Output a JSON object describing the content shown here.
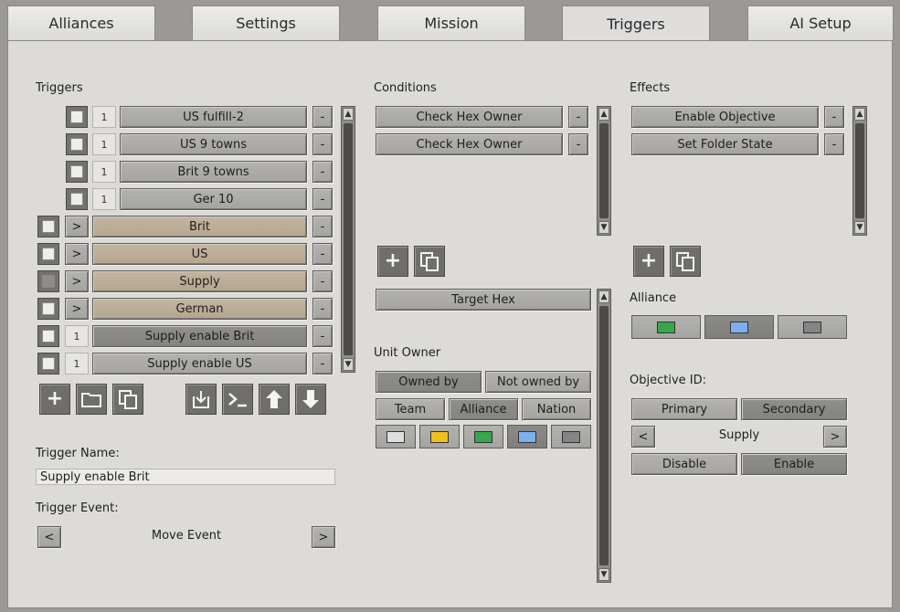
{
  "tabs": [
    {
      "label": "Alliances"
    },
    {
      "label": "Settings"
    },
    {
      "label": "Mission"
    },
    {
      "label": "Triggers"
    },
    {
      "label": "AI Setup"
    }
  ],
  "active_tab": "Triggers",
  "triggers": {
    "heading": "Triggers",
    "items": [
      {
        "count": "1",
        "label": "US fulfill-2"
      },
      {
        "count": "1",
        "label": "US 9 towns"
      },
      {
        "count": "1",
        "label": "Brit 9 towns"
      },
      {
        "count": "1",
        "label": "Ger 10"
      },
      {
        "count": ">",
        "label": "Brit"
      },
      {
        "count": ">",
        "label": "US"
      },
      {
        "count": ">",
        "label": "Supply"
      },
      {
        "count": ">",
        "label": "German"
      },
      {
        "count": "1",
        "label": "Supply enable Brit"
      },
      {
        "count": "1",
        "label": "Supply enable US"
      }
    ],
    "remove_label": "-",
    "name_label": "Trigger Name:",
    "name_value": "Supply enable Brit",
    "event_label": "Trigger Event:",
    "event_value": "Move Event",
    "prev": "<",
    "next": ">"
  },
  "conditions": {
    "heading": "Conditions",
    "items": [
      {
        "label": "Check Hex Owner"
      },
      {
        "label": "Check Hex Owner"
      }
    ],
    "remove_label": "-",
    "target_hex_label": "Target Hex",
    "unit_owner_label": "Unit Owner",
    "owned_by_label": "Owned by",
    "not_owned_by_label": "Not owned by",
    "team_label": "Team",
    "alliance_label": "Alliance",
    "nation_label": "Nation",
    "colors": [
      "#dedede",
      "#f0c020",
      "#3aa64c",
      "#7ab0f2",
      "#848484"
    ]
  },
  "effects": {
    "heading": "Effects",
    "items": [
      {
        "label": "Enable Objective"
      },
      {
        "label": "Set Folder State"
      }
    ],
    "remove_label": "-",
    "alliance_label": "Alliance",
    "alliance_colors": [
      "#3aa64c",
      "#7ab0f2",
      "#848484"
    ],
    "objective_label": "Objective ID:",
    "primary_label": "Primary",
    "secondary_label": "Secondary",
    "objective_value": "Supply",
    "prev": "<",
    "next": ">",
    "disable_label": "Disable",
    "enable_label": "Enable"
  },
  "scroll_up": "▲",
  "scroll_down": "▼"
}
